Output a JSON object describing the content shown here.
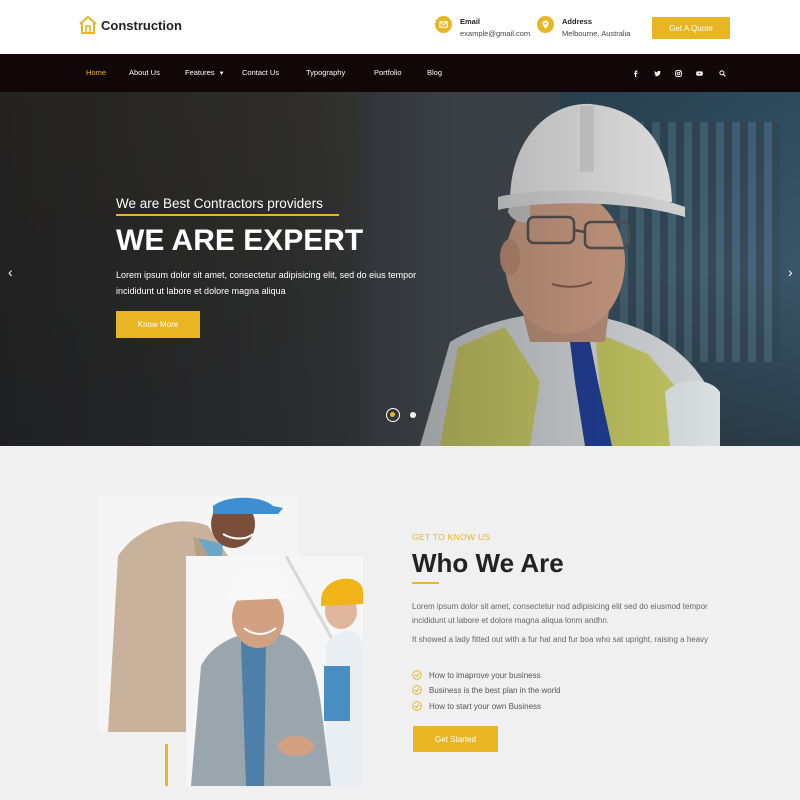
{
  "brand": {
    "name": "Construction",
    "accent": "#e8b623",
    "nav_bg": "#120708"
  },
  "header": {
    "email": {
      "label": "Email",
      "value": "example@gmail.com",
      "icon": "envelope-icon"
    },
    "address": {
      "label": "Address",
      "value": "Melbourne, Australia",
      "icon": "map-pin-icon"
    },
    "quote_button": "Get A Quote"
  },
  "nav": {
    "items": [
      "Home",
      "About Us",
      "Features",
      "Contact Us",
      "Typography",
      "Portfolio",
      "Blog"
    ],
    "active": "Home",
    "social_icons": [
      "facebook-icon",
      "twitter-icon",
      "instagram-icon",
      "youtube-icon",
      "search-icon"
    ]
  },
  "hero": {
    "subtitle": "We are Best Contractors providers",
    "title": "WE ARE EXPERT",
    "text": "Lorem ipsum dolor sit amet, consectetur adipisicing elit, sed do eius tempor incididunt ut labore et dolore magna aliqua",
    "button": "Know More",
    "slides_total": 2,
    "slide_active": 1
  },
  "about": {
    "eyebrow": "GET TO KNOW US",
    "title": "Who We Are",
    "paragraph1": "Lorem ipsum dolor sit amet, consectetur nod adipisicing elit sed do eiusmod tempor incididunt ut labore et dolore magna aliqua lonm andhn.",
    "paragraph2": "It showed a lady fitted out with a fur hat and fur boa who sat upright, raising a heavy",
    "checklist": [
      "How to imaprove your business",
      "Business is the best plan in the world",
      "How to start your own Business"
    ],
    "button": "Get Started"
  }
}
